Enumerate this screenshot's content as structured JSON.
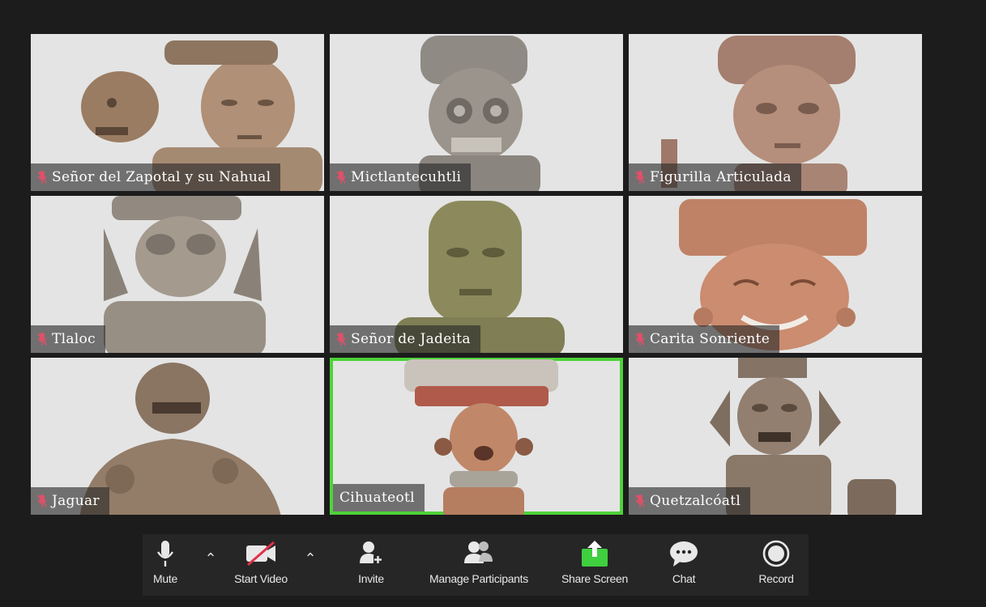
{
  "participants": [
    {
      "name": "Señor del Zapotal y su Nahual",
      "muted": true,
      "active": false
    },
    {
      "name": "Mictlantecuhtli",
      "muted": true,
      "active": false
    },
    {
      "name": "Figurilla Articulada",
      "muted": true,
      "active": false
    },
    {
      "name": "Tlaloc",
      "muted": true,
      "active": false
    },
    {
      "name": "Señor de Jadeita",
      "muted": true,
      "active": false
    },
    {
      "name": "Carita Sonriente",
      "muted": true,
      "active": false
    },
    {
      "name": "Jaguar",
      "muted": true,
      "active": false
    },
    {
      "name": "Cihuateotl",
      "muted": false,
      "active": true
    },
    {
      "name": "Quetzalcóatl",
      "muted": true,
      "active": false
    }
  ],
  "toolbar": {
    "mute": "Mute",
    "start_video": "Start Video",
    "invite": "Invite",
    "manage_participants": "Manage Participants",
    "share_screen": "Share Screen",
    "chat": "Chat",
    "record": "Record"
  },
  "colors": {
    "active_speaker": "#4ed23a",
    "muted_mic": "#e0506a",
    "share_screen": "#3fcf3f",
    "background": "#1c1c1c"
  }
}
